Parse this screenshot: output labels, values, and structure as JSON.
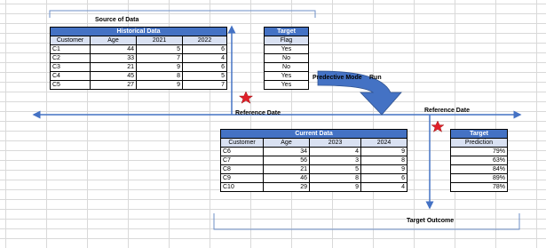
{
  "labels": {
    "source_of_data": "Source of Data",
    "predictive_model": "Predective Mode",
    "run": "Run",
    "reference_date_left": "Reference Date",
    "reference_date_right": "Reference Date",
    "target_outcome": "Target Outcome"
  },
  "historical": {
    "title": "Historical Data",
    "columns": [
      "Customer",
      "Age",
      "2021",
      "2022"
    ],
    "rows": [
      [
        "C1",
        "44",
        "5",
        "6"
      ],
      [
        "C2",
        "33",
        "7",
        "4"
      ],
      [
        "C3",
        "21",
        "9",
        "6"
      ],
      [
        "C4",
        "45",
        "8",
        "5"
      ],
      [
        "C5",
        "27",
        "9",
        "7"
      ]
    ]
  },
  "target_flag": {
    "title": "Target",
    "column": "Flag",
    "values": [
      "Yes",
      "No",
      "No",
      "Yes",
      "Yes"
    ]
  },
  "current": {
    "title": "Current Data",
    "columns": [
      "Customer",
      "Age",
      "2023",
      "2024"
    ],
    "rows": [
      [
        "C6",
        "34",
        "4",
        "9"
      ],
      [
        "C7",
        "56",
        "3",
        "8"
      ],
      [
        "C8",
        "21",
        "5",
        "9"
      ],
      [
        "C9",
        "46",
        "8",
        "6"
      ],
      [
        "C10",
        "29",
        "9",
        "4"
      ]
    ]
  },
  "target_prediction": {
    "title": "Target",
    "column": "Prediction",
    "values": [
      "79%",
      "63%",
      "84%",
      "89%",
      "78%"
    ]
  },
  "colors": {
    "header_blue": "#4472c4",
    "header_light": "#d9e1f2",
    "arrow_blue": "#4472c4",
    "star_red": "#e0202a"
  },
  "icons": [
    "star-icon",
    "curved-arrow-icon",
    "double-arrow-icon"
  ]
}
